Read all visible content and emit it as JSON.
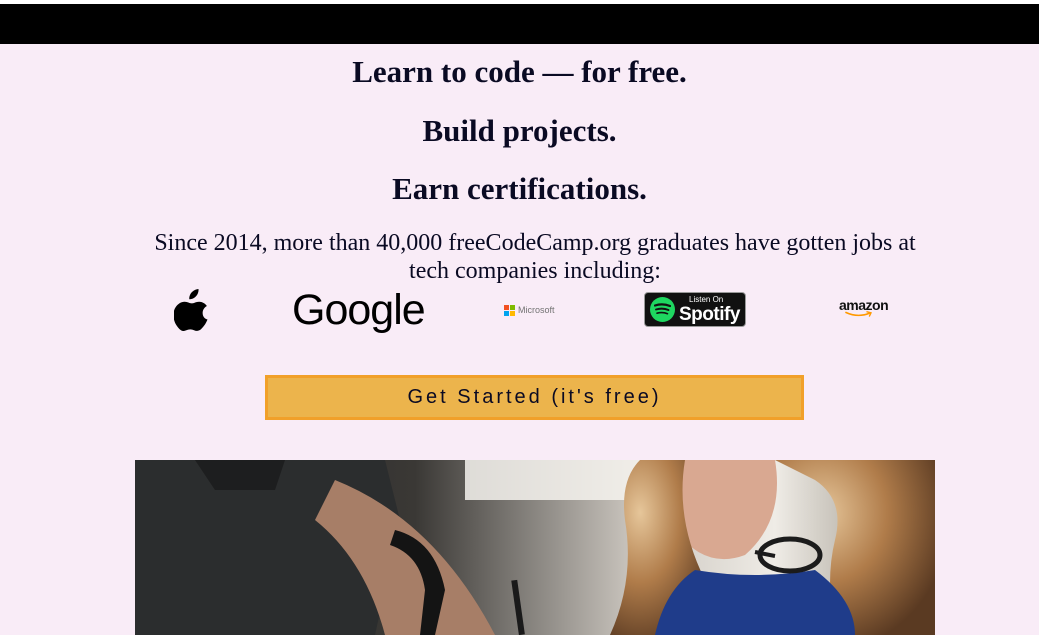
{
  "header": {
    "line1": "Learn to code — for free.",
    "line2": "Build projects.",
    "line3": "Earn certifications."
  },
  "tagline": "Since 2014, more than 40,000 freeCodeCamp.org graduates have gotten jobs at tech companies including:",
  "logos": {
    "apple_icon": "apple-logo",
    "google": "Google",
    "microsoft": "Microsoft",
    "spotify_small": "Listen On",
    "spotify_big": "Spotify",
    "amazon": "amazon"
  },
  "cta": {
    "label": "Get Started (it's free)"
  },
  "colors": {
    "background": "#f9ecf7",
    "navbar": "#000000",
    "cta_fill": "#ecb44c",
    "cta_border": "#f1a02a",
    "spotify_green": "#1ed760"
  }
}
